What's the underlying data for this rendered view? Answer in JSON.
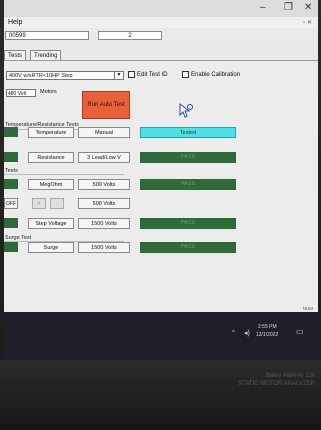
{
  "window": {
    "menu_help": "Help",
    "id_left": "00599",
    "id_right": "2",
    "minimize_glyph": "–",
    "restore_glyph": "❐",
    "close_glyph": "✕"
  },
  "tabs": [
    {
      "label": "Tests"
    },
    {
      "label": "Trending"
    }
  ],
  "config": {
    "test_select": "400V w/sRTR<10HP Step",
    "edit_test_id_label": "Edit Test ID",
    "enable_calibration_label": "Enable Calibration",
    "voltage_select": "480 Volt",
    "motors_label": "Motors",
    "run_auto_test_label": "Run Auto Test"
  },
  "groups": {
    "temp_res": "Temperature/Resistance Tests",
    "tests": "Tests",
    "surge": "Surge Test"
  },
  "rows": [
    {
      "button": "Temperature",
      "param": "Manual",
      "status": "Tested"
    },
    {
      "button": "Resistance",
      "param": "3 Lead/Low V",
      "status": "PASS"
    },
    {
      "button": "MegOhm",
      "param": "500 Volts",
      "status": "PASS"
    },
    {
      "button": "",
      "param": "500 Volts",
      "status": ""
    },
    {
      "button": "Step Voltage",
      "param": "1500 Volts",
      "status": "PASS"
    },
    {
      "button": "Surge",
      "param": "1500 Volts",
      "status": "PASS"
    }
  ],
  "off_label": "OFF",
  "taskbar": {
    "time": "2:55 PM",
    "date": "12/1/2022",
    "version": "NUM"
  },
  "bezel_text": {
    "line1": "Baker AWA-IV 12k",
    "line2": "STATIC MOTOR ANALYZER"
  },
  "colors": {
    "pass_green": "#2f6b3a",
    "tested_cyan": "#4de0e6",
    "run_button": "#e8603c"
  }
}
